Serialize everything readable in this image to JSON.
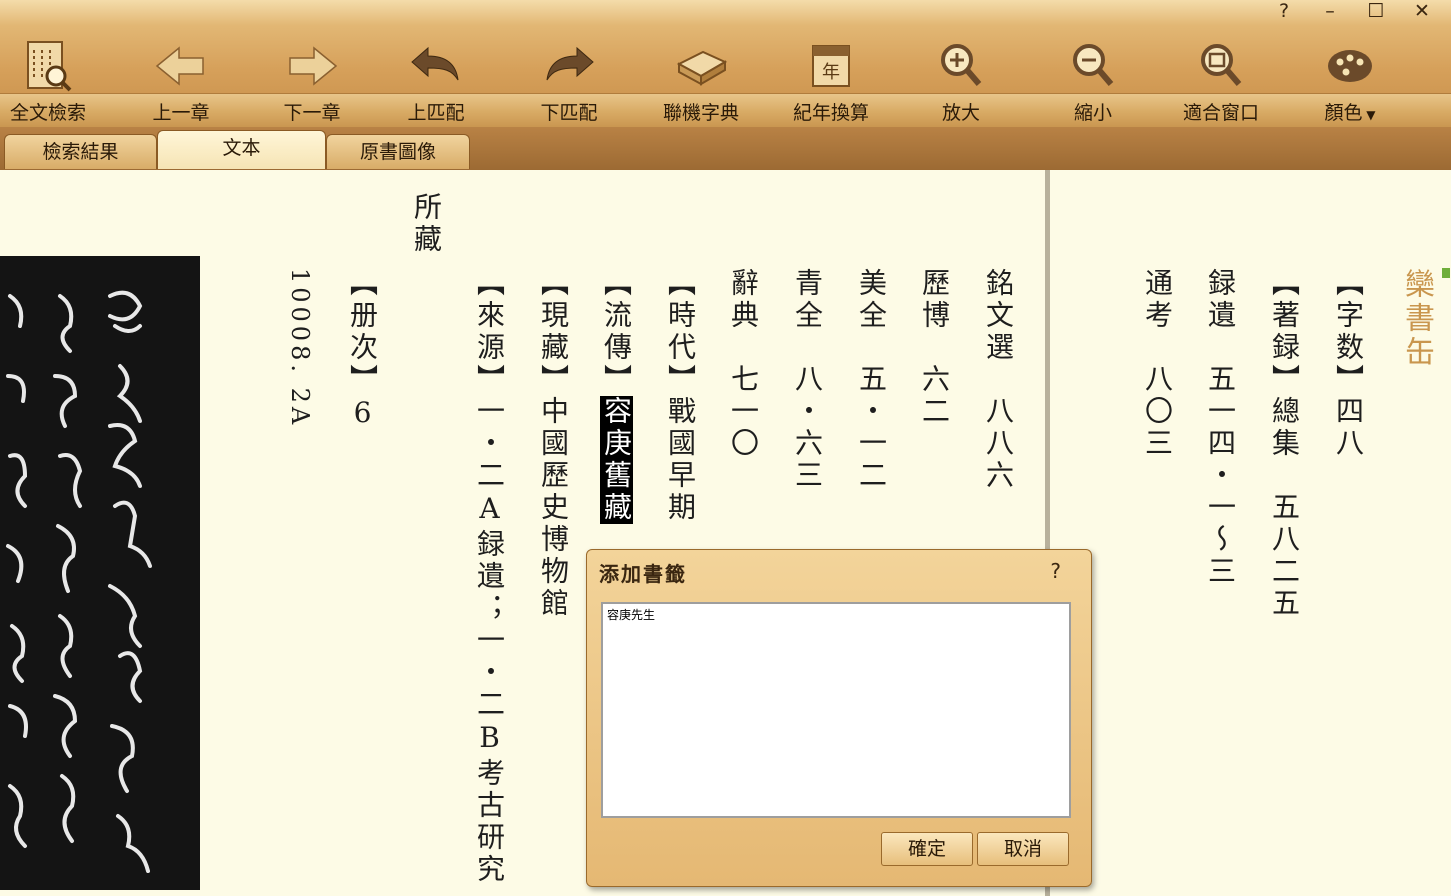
{
  "window": {
    "help": "?",
    "minimize": "–",
    "maximize": "☐",
    "close": "✕"
  },
  "toolbar": {
    "buttons": [
      {
        "label": "全文檢索",
        "icon": "search-book-icon"
      },
      {
        "label": "上一章",
        "icon": "arrow-left-icon"
      },
      {
        "label": "下一章",
        "icon": "arrow-right-icon"
      },
      {
        "label": "上匹配",
        "icon": "curved-arrow-left-icon"
      },
      {
        "label": "下匹配",
        "icon": "curved-arrow-right-icon"
      },
      {
        "label": "聯機字典",
        "icon": "dictionary-icon"
      },
      {
        "label": "紀年換算",
        "icon": "calendar-icon"
      },
      {
        "label": "放大",
        "icon": "zoom-in-icon"
      },
      {
        "label": "縮小",
        "icon": "zoom-out-icon"
      },
      {
        "label": "適合窗口",
        "icon": "fit-window-icon"
      },
      {
        "label": "顏色",
        "icon": "palette-icon"
      }
    ]
  },
  "tabs": [
    {
      "label": "檢索結果"
    },
    {
      "label": "文本",
      "active": true
    },
    {
      "label": "原書圖像"
    }
  ],
  "text": {
    "title": "欒書缶",
    "col_zishu": "【字数】四八",
    "col_zhulu": "【著録】總集　五八二五",
    "col_luyi": "録遺　五一四・一～三",
    "col_tongkao": "通考　八〇三",
    "col_mingwen": "銘文選　八八六",
    "col_libo": "歷博　六二",
    "col_meiquan": "美全　五・一二",
    "col_qingquan": "青全　八・六三",
    "col_cidian": "辭典　七一〇",
    "col_shidai": "【時代】戰國早期",
    "col_liuchuan_a": "【流傳】",
    "col_liuchuan_b": "容庚舊藏",
    "col_xiancang": "【現藏】中國歷史博物館",
    "col_laiyuan": "【來源】一・二A録遺；一・二B考古研究",
    "col_suocang": "所藏",
    "col_cece": "【册次】6",
    "col_page": "10008. 2A"
  },
  "dialog": {
    "title": "添加書籤",
    "help": "?",
    "text_value": "容庚先生",
    "ok": "確定",
    "cancel": "取消"
  }
}
